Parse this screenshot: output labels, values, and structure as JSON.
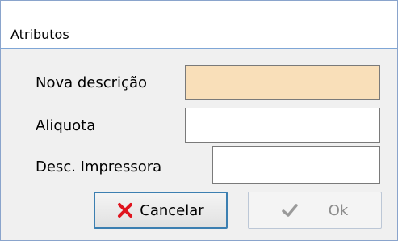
{
  "dialog": {
    "title": "Atributos"
  },
  "form": {
    "nova_descricao_label": "Nova descrição",
    "nova_descricao_value": "",
    "aliquota_label": "Aliquota",
    "aliquota_value": "",
    "desc_impressora_label": "Desc. Impressora",
    "desc_impressora_value": ""
  },
  "buttons": {
    "cancel_label": "Cancelar",
    "cancel_icon": "x-icon",
    "ok_label": "Ok",
    "ok_icon": "checkmark-icon",
    "ok_enabled": false
  },
  "colors": {
    "focused_field_bg": "#f9dfb9",
    "cancel_icon_color": "#e0141e",
    "default_button_border": "#3c7fb1"
  }
}
